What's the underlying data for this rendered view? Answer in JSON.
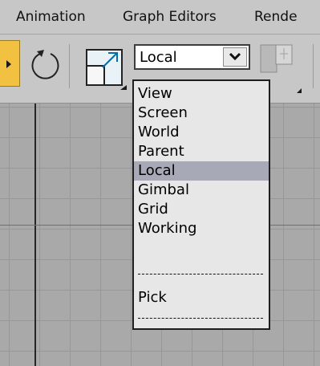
{
  "menubar": {
    "items": [
      {
        "label": "Animation"
      },
      {
        "label": "Graph Editors"
      },
      {
        "label": "Rende"
      }
    ]
  },
  "toolbar": {
    "coordinate_system": {
      "selected": "Local"
    }
  },
  "dropdown": {
    "options": [
      "View",
      "Screen",
      "World",
      "Parent",
      "Local",
      "Gimbal",
      "Grid",
      "Working"
    ],
    "selected_option": "Local",
    "pick_label": "Pick"
  },
  "icons": {
    "move": "move-icon",
    "rotate": "rotate-icon",
    "scale": "scale-icon",
    "dropdown_arrow": "chevron-down-icon",
    "pivot": "pivot-center-icon"
  },
  "colors": {
    "menubar_bg": "#c7c7c7",
    "viewport_bg": "#a9a9a9",
    "active_tool": "#f3c141",
    "selection_highlight": "#a8a9b7",
    "dropdown_bg": "#e7e7e7"
  }
}
